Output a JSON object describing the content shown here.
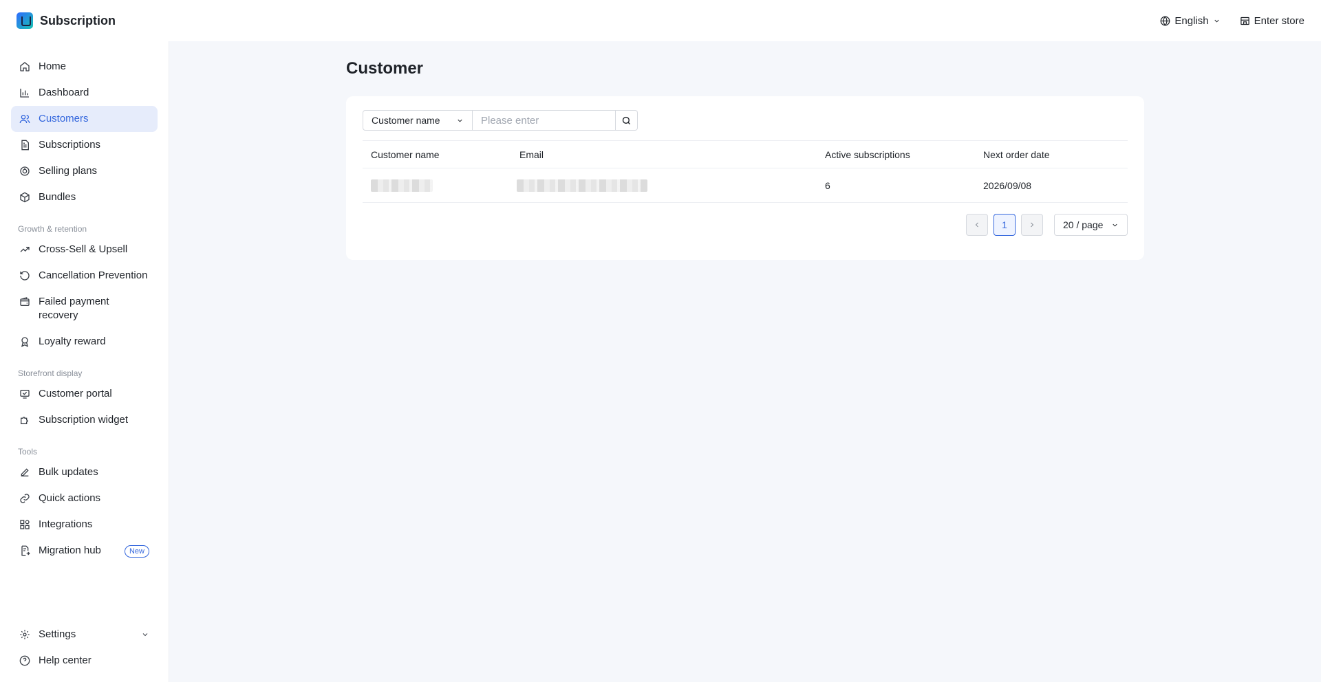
{
  "app": {
    "title": "Subscription"
  },
  "topbar": {
    "language": "English",
    "enter_store": "Enter store"
  },
  "sidebar": {
    "main_items": [
      {
        "label": "Home",
        "icon": "home-icon"
      },
      {
        "label": "Dashboard",
        "icon": "chart-icon"
      },
      {
        "label": "Customers",
        "icon": "users-icon",
        "active": true
      },
      {
        "label": "Subscriptions",
        "icon": "document-icon"
      },
      {
        "label": "Selling plans",
        "icon": "plan-icon"
      },
      {
        "label": "Bundles",
        "icon": "box-icon"
      }
    ],
    "sections": [
      {
        "label": "Growth & retention",
        "items": [
          {
            "label": "Cross-Sell & Upsell",
            "icon": "trend-up-icon"
          },
          {
            "label": "Cancellation Prevention",
            "icon": "history-icon"
          },
          {
            "label": "Failed payment recovery",
            "icon": "wallet-icon"
          },
          {
            "label": "Loyalty reward",
            "icon": "award-icon"
          }
        ]
      },
      {
        "label": "Storefront display",
        "items": [
          {
            "label": "Customer portal",
            "icon": "portal-icon"
          },
          {
            "label": "Subscription widget",
            "icon": "puzzle-icon"
          }
        ]
      },
      {
        "label": "Tools",
        "items": [
          {
            "label": "Bulk updates",
            "icon": "edit-icon"
          },
          {
            "label": "Quick actions",
            "icon": "link-icon"
          },
          {
            "label": "Integrations",
            "icon": "grid-icon"
          },
          {
            "label": "Migration hub",
            "icon": "migrate-icon",
            "badge": "New"
          }
        ]
      }
    ],
    "bottom_items": [
      {
        "label": "Settings",
        "icon": "gear-icon"
      },
      {
        "label": "Help center",
        "icon": "help-icon"
      }
    ]
  },
  "page": {
    "title": "Customer"
  },
  "filter": {
    "field": "Customer name",
    "placeholder": "Please enter"
  },
  "table": {
    "headers": [
      "Customer name",
      "Email",
      "Active subscriptions",
      "Next order date"
    ],
    "rows": [
      {
        "active_subscriptions": "6",
        "next_order_date": "2026/09/08"
      }
    ]
  },
  "pagination": {
    "current_page": "1",
    "page_size": "20 / page"
  },
  "colors": {
    "accent": "#3366dd",
    "active_bg": "#e6ecfb",
    "page_bg": "#f5f7fb"
  }
}
